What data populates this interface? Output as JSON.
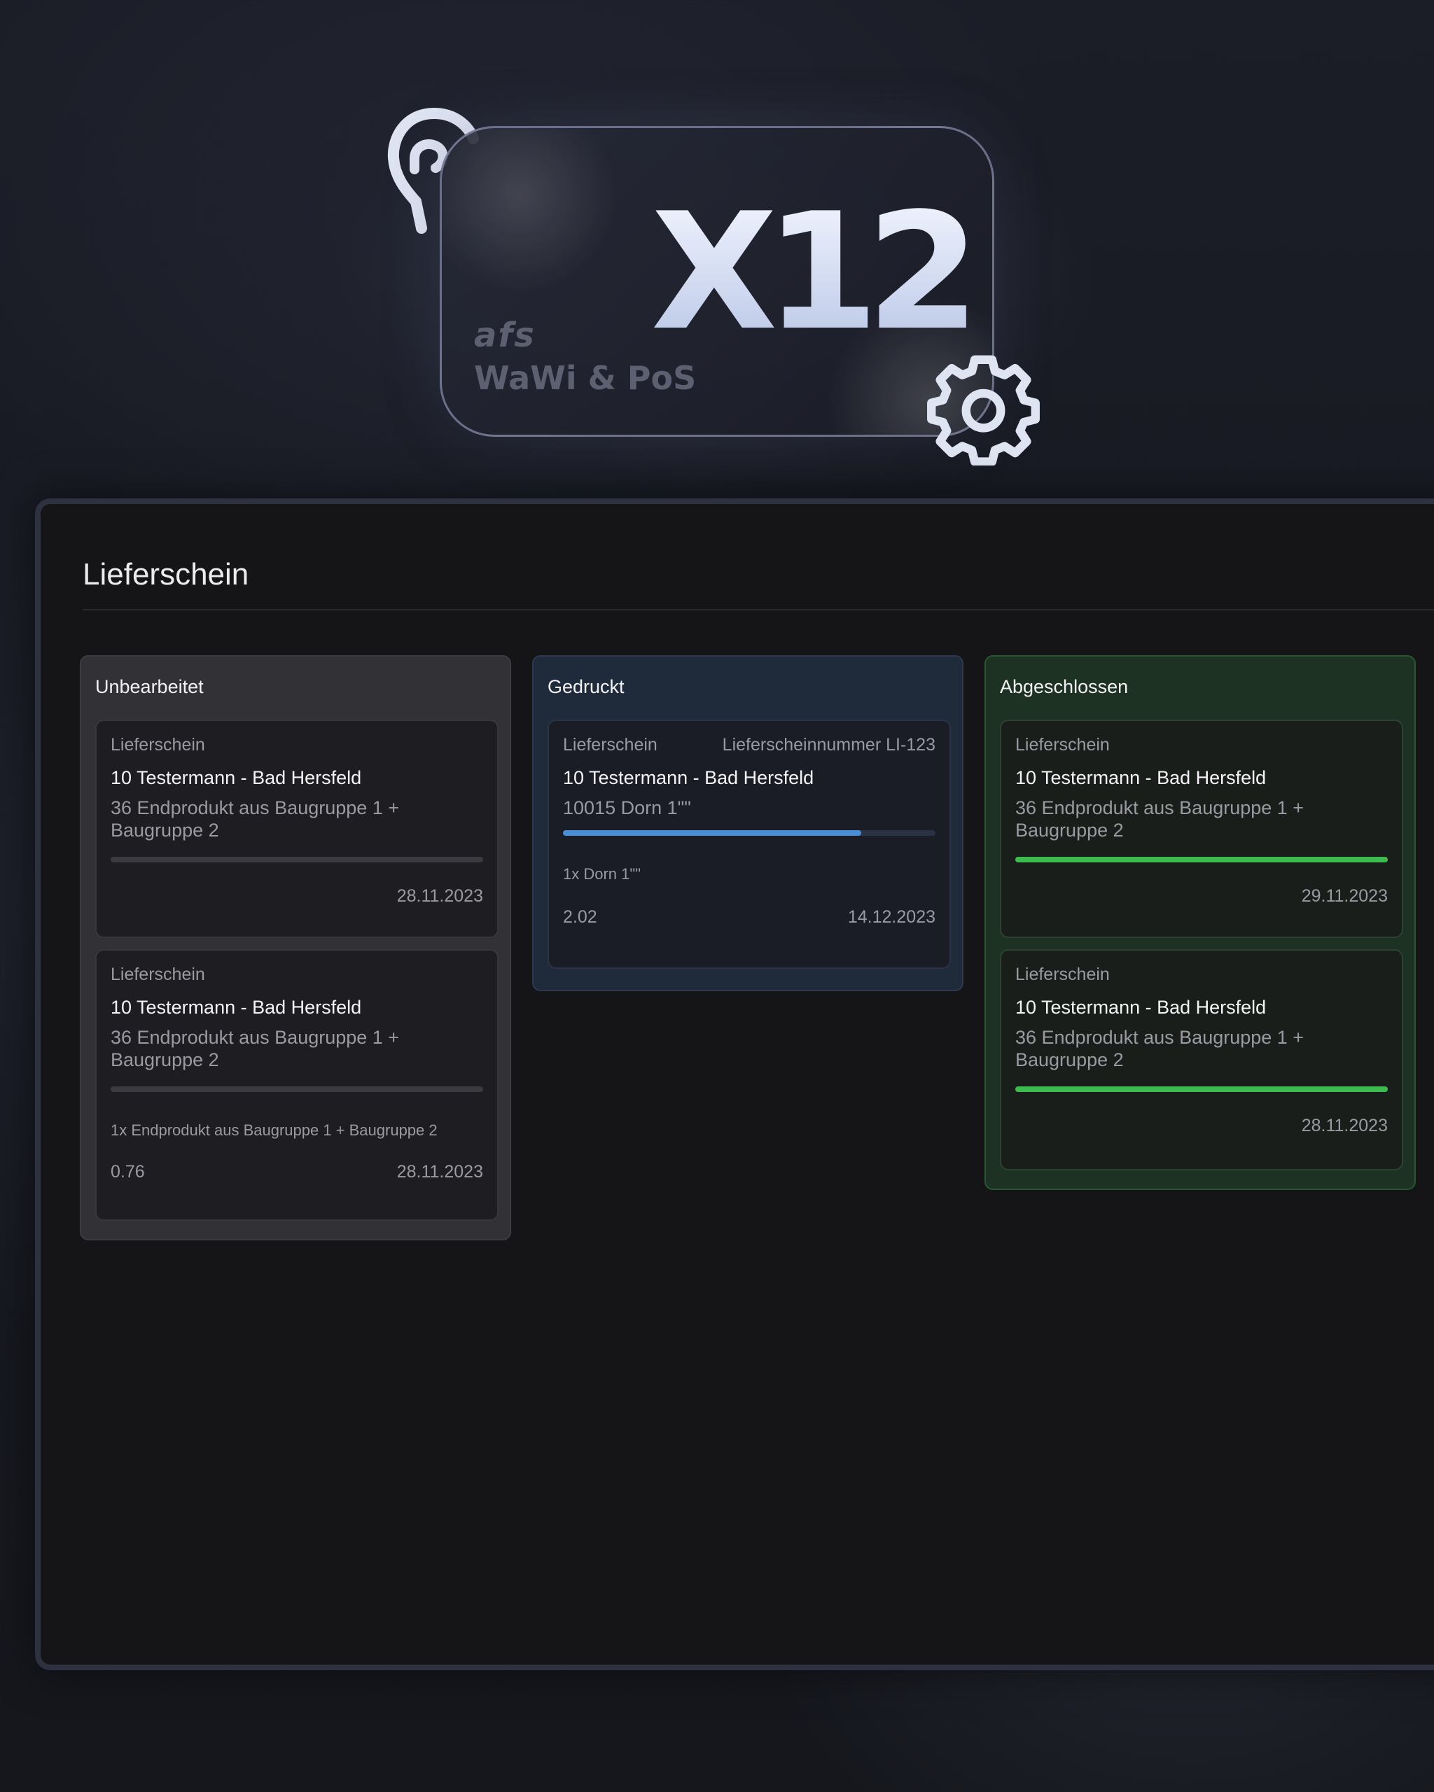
{
  "logo": {
    "product": "X12",
    "brand": "afs",
    "subtitle": "WaWi & PoS"
  },
  "page": {
    "title": "Lieferschein"
  },
  "columns": [
    {
      "title": "Unbearbeitet",
      "color": "#313136",
      "cards": [
        {
          "type": "Lieferschein",
          "customer": "10 Testermann - Bad Hersfeld",
          "product": "36 Endprodukt aus Baugruppe 1 + Baugruppe 2",
          "progress": 0,
          "date": "28.11.2023"
        },
        {
          "type": "Lieferschein",
          "customer": "10 Testermann - Bad Hersfeld",
          "product": "36 Endprodukt aus Baugruppe 1 + Baugruppe 2",
          "progress": 0,
          "detail": "1x Endprodukt aus Baugruppe 1 + Baugruppe 2",
          "value": "0.76",
          "date": "28.11.2023"
        }
      ]
    },
    {
      "title": "Gedruckt",
      "color": "#1f2a3b",
      "cards": [
        {
          "type": "Lieferschein",
          "number": "Lieferscheinnummer LI-123",
          "customer": "10 Testermann - Bad Hersfeld",
          "product": "10015 Dorn 1\"\"",
          "progress": 0.8,
          "progress_color": "#4a8fd6",
          "detail": "1x Dorn 1\"\"",
          "value": "2.02",
          "date": "14.12.2023"
        }
      ]
    },
    {
      "title": "Abgeschlossen",
      "color": "#1d3223",
      "cards": [
        {
          "type": "Lieferschein",
          "customer": "10 Testermann - Bad Hersfeld",
          "product": "36 Endprodukt aus Baugruppe 1 + Baugruppe 2",
          "progress": 1,
          "progress_color": "#3dbb4f",
          "date": "29.11.2023"
        },
        {
          "type": "Lieferschein",
          "customer": "10 Testermann - Bad Hersfeld",
          "product": "36 Endprodukt aus Baugruppe 1 + Baugruppe 2",
          "progress": 1,
          "progress_color": "#3dbb4f",
          "date": "28.11.2023"
        }
      ]
    }
  ]
}
